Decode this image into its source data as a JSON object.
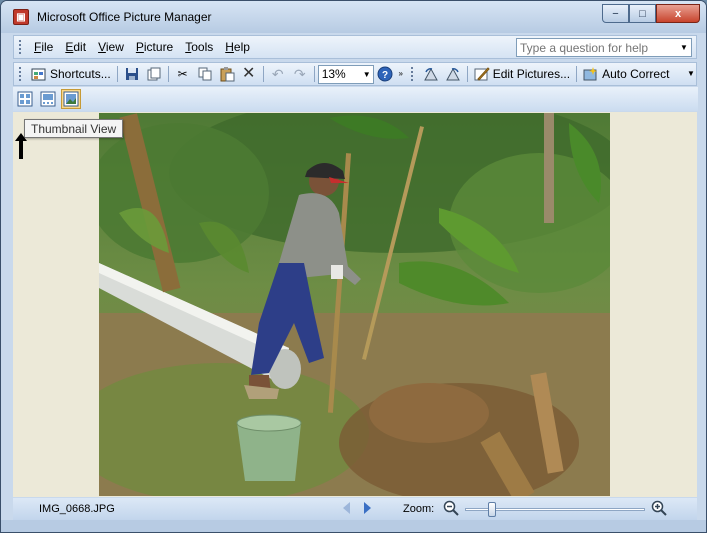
{
  "window": {
    "title": "Microsoft Office Picture Manager",
    "controls": {
      "minimize": "−",
      "maximize": "□",
      "close": "x"
    }
  },
  "menubar": {
    "items": [
      {
        "label": "File",
        "key": "F",
        "rest": "ile"
      },
      {
        "label": "Edit",
        "key": "E",
        "rest": "dit"
      },
      {
        "label": "View",
        "key": "V",
        "rest": "iew"
      },
      {
        "label": "Picture",
        "key": "P",
        "rest": "icture"
      },
      {
        "label": "Tools",
        "key": "T",
        "rest": "ools"
      },
      {
        "label": "Help",
        "key": "H",
        "rest": "elp"
      }
    ],
    "help_placeholder": "Type a question for help"
  },
  "toolbar": {
    "shortcuts_label": "Shortcuts...",
    "zoom_value": "13%",
    "edit_pictures_label": "Edit Pictures...",
    "auto_correct_label": "Auto Correct"
  },
  "viewbar": {
    "tooltip": "Thumbnail View"
  },
  "statusbar": {
    "filename": "IMG_0668.JPG",
    "zoom_label": "Zoom:",
    "zoom_fraction": 0.13
  },
  "colors": {
    "accent": "#c9d9ec",
    "active_view": "#f8d78a",
    "nav_arrow": "#3a6fc4"
  }
}
